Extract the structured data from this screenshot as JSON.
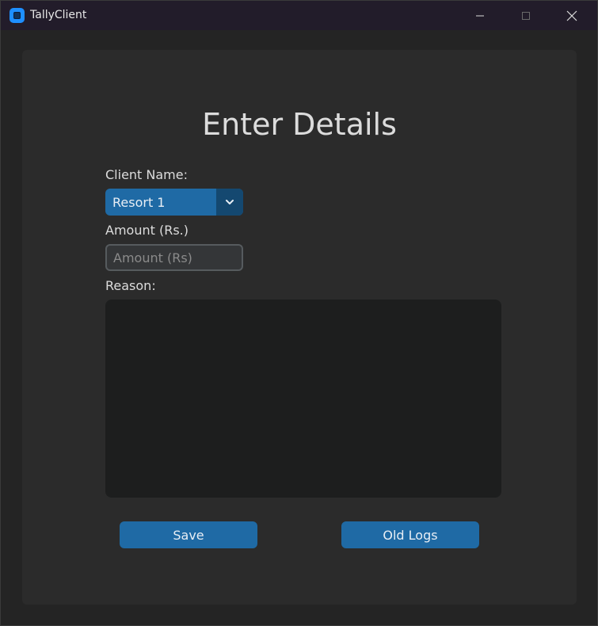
{
  "window": {
    "title": "TallyClient",
    "icon": "app-icon",
    "controls": [
      "minimize-icon",
      "maximize-icon",
      "close-icon"
    ]
  },
  "form": {
    "heading": "Enter Details",
    "client_label": "Client Name:",
    "client_selected": "Resort 1",
    "amount_label": "Amount (Rs.)",
    "amount_value": "",
    "amount_placeholder": "Amount (Rs)",
    "reason_label": "Reason:",
    "reason_value": ""
  },
  "actions": {
    "save_label": "Save",
    "old_logs_label": "Old Logs"
  },
  "colors": {
    "accent": "#1f6aa5",
    "accent_dark": "#144870",
    "panel": "#2b2b2b",
    "background": "#242424",
    "titlebar": "#221c2a"
  }
}
